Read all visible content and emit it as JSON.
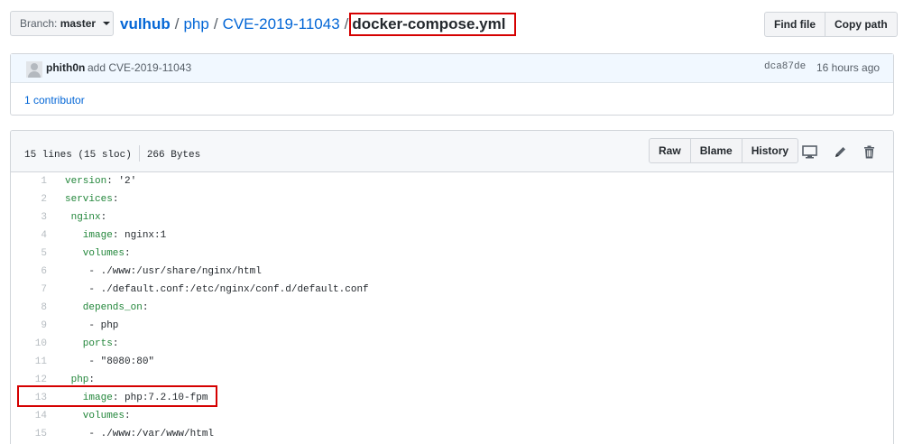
{
  "branch": {
    "label": "Branch:",
    "value": "master"
  },
  "breadcrumb": {
    "repo": "vulhub",
    "dir1": "php",
    "dir2": "CVE-2019-11043",
    "sep": "/",
    "file": "docker-compose.yml"
  },
  "top_buttons": {
    "find_file": "Find file",
    "copy_path": "Copy path"
  },
  "commit": {
    "author": "phith0n",
    "message": "add CVE-2019-11043",
    "sha": "dca87de",
    "time": "16 hours ago",
    "contributors": "1 contributor"
  },
  "file": {
    "lines": "15 lines (15 sloc)",
    "size": "266 Bytes",
    "buttons": {
      "raw": "Raw",
      "blame": "Blame",
      "history": "History"
    },
    "icons": [
      "desktop-icon",
      "pencil-icon",
      "trash-icon"
    ]
  },
  "code_lines": [
    {
      "n": "1",
      "key": "version",
      "rest": ": '2'"
    },
    {
      "n": "2",
      "key": "services",
      "rest": ":"
    },
    {
      "n": "3",
      "key": " nginx",
      "rest": ":"
    },
    {
      "n": "4",
      "key": "   image",
      "rest": ": nginx:1"
    },
    {
      "n": "5",
      "key": "   volumes",
      "rest": ":"
    },
    {
      "n": "6",
      "key": "",
      "rest": "    - ./www:/usr/share/nginx/html"
    },
    {
      "n": "7",
      "key": "",
      "rest": "    - ./default.conf:/etc/nginx/conf.d/default.conf"
    },
    {
      "n": "8",
      "key": "   depends_on",
      "rest": ":"
    },
    {
      "n": "9",
      "key": "",
      "rest": "    - php"
    },
    {
      "n": "10",
      "key": "   ports",
      "rest": ":"
    },
    {
      "n": "11",
      "key": "",
      "rest": "    - \"8080:80\""
    },
    {
      "n": "12",
      "key": " php",
      "rest": ":"
    },
    {
      "n": "13",
      "key": "   image",
      "rest": ": php:7.2.10-fpm"
    },
    {
      "n": "14",
      "key": "   volumes",
      "rest": ":"
    },
    {
      "n": "15",
      "key": "",
      "rest": "    - ./www:/var/www/html"
    }
  ],
  "colors": {
    "link": "#0366d6",
    "highlight_border": "#d50000",
    "yaml_key": "#22863a"
  }
}
